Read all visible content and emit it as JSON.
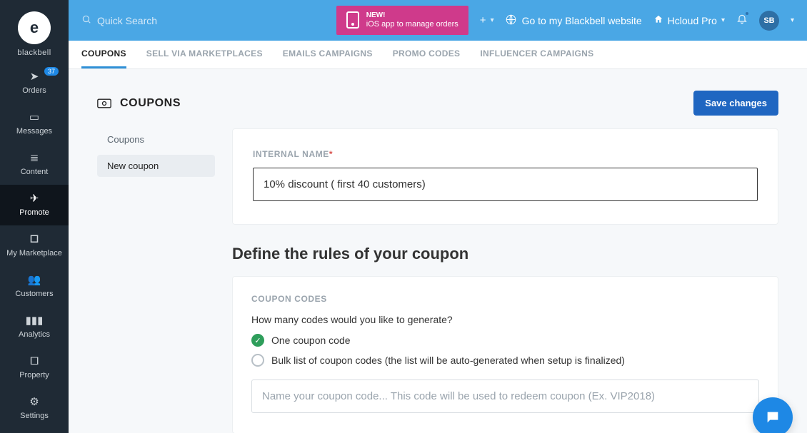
{
  "brand": {
    "name": "blackbell",
    "logo_text": "e"
  },
  "sidebar": {
    "items": [
      {
        "label": "Orders",
        "icon": "location-arrow",
        "badge": "37"
      },
      {
        "label": "Messages",
        "icon": "laptop"
      },
      {
        "label": "Content",
        "icon": "book"
      },
      {
        "label": "Promote",
        "icon": "paper-plane",
        "active": true
      },
      {
        "label": "My Marketplace",
        "icon": "briefcase"
      },
      {
        "label": "Customers",
        "icon": "users"
      },
      {
        "label": "Analytics",
        "icon": "chart"
      },
      {
        "label": "Property",
        "icon": "building"
      },
      {
        "label": "Settings",
        "icon": "gear"
      }
    ]
  },
  "topbar": {
    "search_placeholder": "Quick Search",
    "promo_new": "NEW!",
    "promo_sub": "iOS app to manage orders",
    "goto_label": "Go to my Blackbell website",
    "account_label": "Hcloud Pro",
    "avatar_initials": "SB"
  },
  "tabs": [
    {
      "label": "COUPONS",
      "active": true
    },
    {
      "label": "SELL VIA MARKETPLACES"
    },
    {
      "label": "EMAILS CAMPAIGNS"
    },
    {
      "label": "PROMO CODES"
    },
    {
      "label": "INFLUENCER CAMPAIGNS"
    }
  ],
  "page": {
    "title": "COUPONS",
    "save_button": "Save changes",
    "subnav": [
      {
        "label": "Coupons"
      },
      {
        "label": "New coupon",
        "active": true
      }
    ],
    "internal_name_label": "INTERNAL NAME",
    "internal_name_value": "10% discount ( first 40 customers)",
    "rules_title": "Define the rules of your coupon",
    "coupon_codes_label": "COUPON CODES",
    "codes_question": "How many codes would you like to generate?",
    "option_one": "One coupon code",
    "option_bulk": "Bulk list of coupon codes (the list will be auto-generated when setup is finalized)",
    "code_input_placeholder": "Name your coupon code... This code will be used to redeem coupon (Ex. VIP2018)"
  },
  "colors": {
    "topbar": "#4aa7e5",
    "promo": "#cf3a8b",
    "primary_btn": "#1f66c1",
    "sidebar": "#1f2a35"
  }
}
